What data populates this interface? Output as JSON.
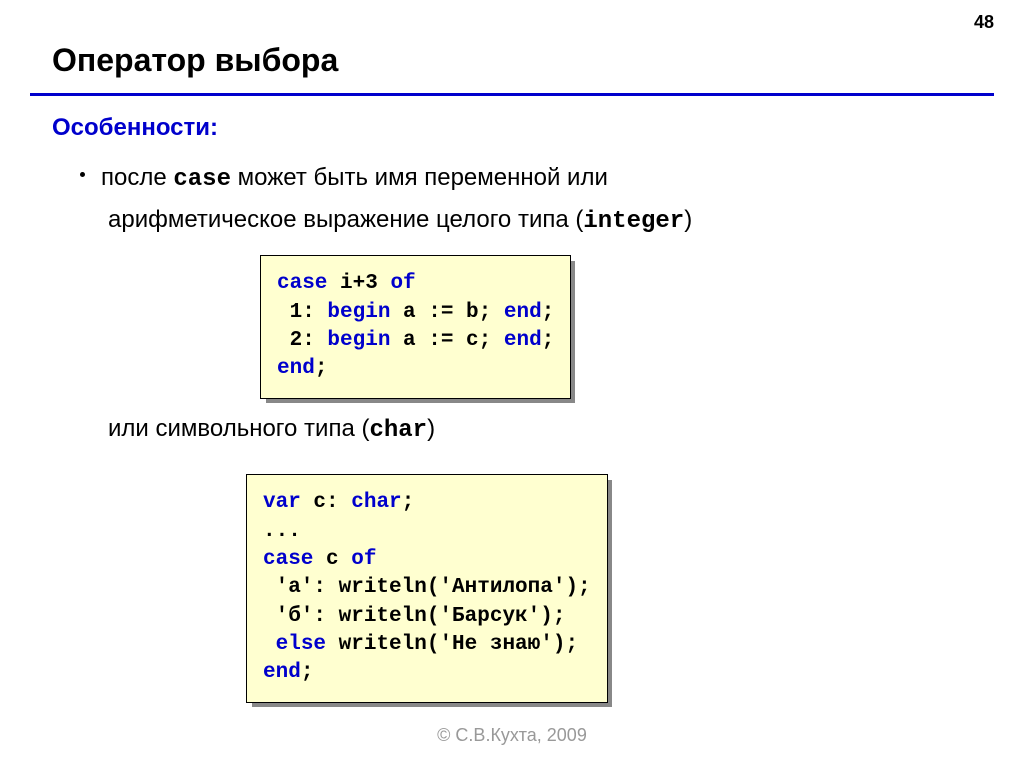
{
  "page_number": "48",
  "title": "Оператор выбора",
  "section_heading": "Особенности:",
  "bullet_pre": "после ",
  "bullet_kw_case": "case",
  "bullet_post": " может быть имя переменной или",
  "bullet_line2_pre": "арифметическое выражение целого типа (",
  "bullet_line2_kw": "integer",
  "bullet_line2_post": ")",
  "code1": {
    "l1a": "case",
    "l1b": " i+3 ",
    "l1c": "of",
    "l2a": " 1: ",
    "l2b": "begin",
    "l2c": " a := b; ",
    "l2d": "end",
    "l2e": ";",
    "l3a": " 2: ",
    "l3b": "begin",
    "l3c": " a := c; ",
    "l3d": "end",
    "l3e": ";",
    "l4a": "end",
    "l4b": ";"
  },
  "middle_text_pre": "или символьного типа (",
  "middle_text_kw": "char",
  "middle_text_post": ")",
  "code2": {
    "l1a": "var",
    "l1b": " c: ",
    "l1c": "char",
    "l1d": ";",
    "l2": "...",
    "l3a": "case",
    "l3b": " c ",
    "l3c": "of",
    "l4": " 'а': writeln('Антилопа');",
    "l5": " 'б': writeln('Барсук');",
    "l6a": " ",
    "l6b": "else",
    "l6c": " writeln('Не знаю');",
    "l7a": "end",
    "l7b": ";"
  },
  "copyright": "© С.В.Кухта, 2009"
}
